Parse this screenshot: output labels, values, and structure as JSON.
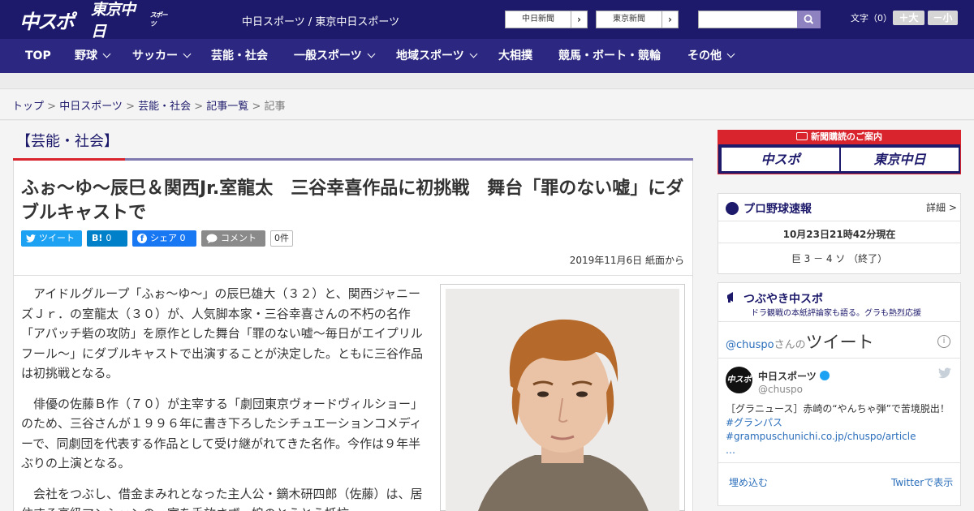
{
  "header": {
    "logo_chuspo": "中スポ",
    "logo_tokyo": "東京中日",
    "logo_tokyo_sub": "スポーツ",
    "site_links": "中日スポーツ / 東京中日スポーツ",
    "paper_buttons": [
      {
        "label": "中日新聞",
        "arrow": "›"
      },
      {
        "label": "東京新聞",
        "arrow": "›"
      }
    ],
    "search_placeholder": "",
    "font_label": "文字（0）",
    "font_large": "＋大",
    "font_small": "－小"
  },
  "nav": {
    "items": [
      {
        "label": "TOP",
        "dropdown": false
      },
      {
        "label": "野球",
        "dropdown": true
      },
      {
        "label": "サッカー",
        "dropdown": true
      },
      {
        "label": "芸能・社会",
        "dropdown": false
      },
      {
        "label": "一般スポーツ",
        "dropdown": true
      },
      {
        "label": "地域スポーツ",
        "dropdown": true
      },
      {
        "label": "大相撲",
        "dropdown": false
      },
      {
        "label": "競馬・ボート・競輪",
        "dropdown": false
      },
      {
        "label": "その他",
        "dropdown": true
      }
    ]
  },
  "breadcrumb": {
    "items": [
      "トップ",
      "中日スポーツ",
      "芸能・社会",
      "記事一覧"
    ],
    "separator": " > ",
    "current": "記事"
  },
  "article": {
    "category": "【芸能・社会】",
    "headline": "ふぉ～ゆ～辰巳＆関西Jr.室龍太　三谷幸喜作品に初挑戦　舞台「罪のない嘘」にダブルキャストで",
    "share": {
      "tweet": "ツイート",
      "hatena_icon": "B!",
      "hatena_count": "0",
      "facebook": "シェア 0",
      "comment": "コメント",
      "comment_count": "0件"
    },
    "date": "2019年11月6日 紙面から",
    "paragraphs": [
      "アイドルグループ「ふぉ～ゆ～」の辰巳雄大（３２）と、関西ジャニーズＪｒ．の室龍太（３０）が、人気脚本家・三谷幸喜さんの不朽の名作「アパッチ砦の攻防」を原作とした舞台「罪のない嘘～毎日がエイプリルフール～」にダブルキャストで出演することが決定した。ともに三谷作品は初挑戦となる。",
      "俳優の佐藤Ｂ作（７０）が主宰する「劇団東京ヴォードヴィルショー」のため、三谷さんが１９９６年に書き下ろしたシチュエーションコメディーで、同劇団を代表する作品として受け継がれてきた名作。今作は９年半ぶりの上演となる。",
      "会社をつぶし、借金まみれとなった主人公・鏑木研四郎（佐藤）は、居住する高級マンションの一室を手放さず、娘のとうとう抵抗"
    ]
  },
  "sidebar": {
    "ad_top": "新聞購読のご案内",
    "ad_cards": [
      "中スポ",
      "東京中日"
    ],
    "baseball": {
      "title": "プロ野球速報",
      "detail": "詳細 >",
      "time": "10月23日21時42分現在",
      "score": "巨 3 － 4 ソ （終了）"
    },
    "tsubuyaki": {
      "title": "つぶやき中スポ",
      "subtitle": "ドラ観戦の本紙評論家も語る。グラも熱烈応援",
      "tweet_head_handle": "@chuspo",
      "tweet_head_mid": "さんの",
      "tweet_head_big": "ツイート",
      "account_name": "中日スポーツ",
      "account_handle": "@chuspo",
      "avatar_text": "中スポ",
      "tweet_text": "［グラニュース］赤崎の“やんちゃ弾”で苦境脱出！",
      "tweet_hash1": "#グランパス",
      "tweet_hash2": "#grampuschunichi.co.jp/chuspo/article",
      "tweet_ellipsis": "…",
      "embed": "埋め込む",
      "view_on_twitter": "Twitterで表示"
    }
  },
  "colors": {
    "header_bg": "#1d1a6b",
    "nav_bg": "#2c2881",
    "accent_red": "#d9232d",
    "twitter": "#1da1f2"
  }
}
